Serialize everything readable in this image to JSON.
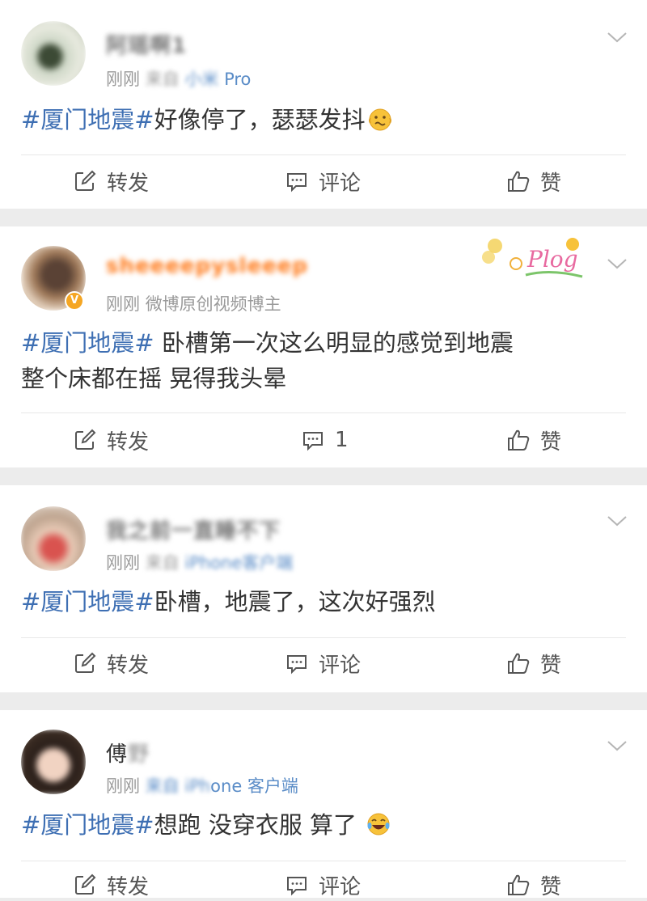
{
  "actions": {
    "repost": "转发",
    "comment": "评论",
    "like": "赞"
  },
  "posts": [
    {
      "username": "阿瑶啊1",
      "time": "刚刚",
      "source_prefix": "来自",
      "source_blur": "小米",
      "source_suffix": "Pro",
      "hashtag": "#厦门地震#",
      "text": "好像停了，瑟瑟发抖",
      "comment_label": "评论"
    },
    {
      "username": "sheeeepysleeep",
      "time": "刚刚",
      "badge": "微博原创视频博主",
      "hashtag": "#厦门地震#",
      "text": "卧槽第一次这么明显的感觉到地震",
      "text2": "整个床都在摇 晃得我头晕",
      "comment_label": "1",
      "sticker": "Plog"
    },
    {
      "username": "我之前一直睡不下",
      "time": "刚刚",
      "source_prefix": "来自",
      "source_blur": "iPhone客户端",
      "hashtag": "#厦门地震#",
      "text": "卧槽，地震了，这次好强烈",
      "comment_label": "评论"
    },
    {
      "username": "傅",
      "username_blur": "野",
      "time": "刚刚",
      "source_blur": "来自 iPh",
      "source_suffix": "one 客户端",
      "hashtag": "#厦门地震#",
      "text": "想跑 没穿衣服 算了",
      "comment_label": "评论"
    }
  ],
  "icons": {
    "repost": "edit-square-icon",
    "comment": "comment-bubble-icon",
    "like": "thumbs-up-icon",
    "menu": "chevron-down-icon"
  },
  "colors": {
    "hashtag": "#3e6fb3",
    "orange_name": "#ff7a1a",
    "badge": "#f5a623"
  }
}
